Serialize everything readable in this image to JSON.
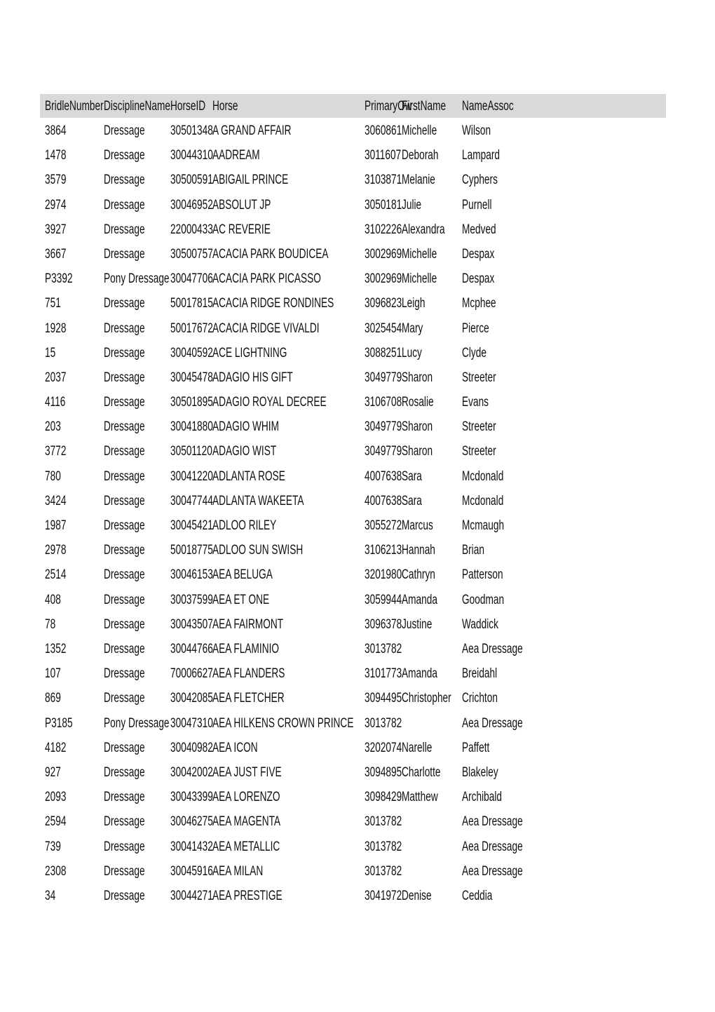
{
  "table": {
    "headers": [
      "BridleNumber",
      "DisciplineName",
      "HorseID",
      "Horse",
      "PrimaryOw",
      "FirstName",
      "NameAssoc"
    ],
    "rows": [
      [
        "3864",
        "Dressage",
        "30501348",
        "A GRAND AFFAIR",
        "3060861",
        "Michelle",
        "Wilson"
      ],
      [
        "1478",
        "Dressage",
        "30044310",
        "AADREAM",
        "3011607",
        "Deborah",
        "Lampard"
      ],
      [
        "3579",
        "Dressage",
        "30500591",
        "ABIGAIL PRINCE",
        "3103871",
        "Melanie",
        "Cyphers"
      ],
      [
        "2974",
        "Dressage",
        "30046952",
        "ABSOLUT JP",
        "3050181",
        "Julie",
        "Purnell"
      ],
      [
        "3927",
        "Dressage",
        "22000433",
        "AC REVERIE",
        "3102226",
        "Alexandra",
        "Medved"
      ],
      [
        "3667",
        "Dressage",
        "30500757",
        "ACACIA PARK BOUDICEA",
        "3002969",
        "Michelle",
        "Despax"
      ],
      [
        "P3392",
        "Pony Dressage",
        "30047706",
        "ACACIA PARK PICASSO",
        "3002969",
        "Michelle",
        "Despax"
      ],
      [
        "751",
        "Dressage",
        "50017815",
        "ACACIA RIDGE RONDINES",
        "3096823",
        "Leigh",
        "Mcphee"
      ],
      [
        "1928",
        "Dressage",
        "50017672",
        "ACACIA RIDGE VIVALDI",
        "3025454",
        "Mary",
        "Pierce"
      ],
      [
        "15",
        "Dressage",
        "30040592",
        "ACE LIGHTNING",
        "3088251",
        "Lucy",
        "Clyde"
      ],
      [
        "2037",
        "Dressage",
        "30045478",
        "ADAGIO HIS GIFT",
        "3049779",
        "Sharon",
        "Streeter"
      ],
      [
        "4116",
        "Dressage",
        "30501895",
        "ADAGIO ROYAL DECREE",
        "3106708",
        "Rosalie",
        "Evans"
      ],
      [
        "203",
        "Dressage",
        "30041880",
        "ADAGIO WHIM",
        "3049779",
        "Sharon",
        "Streeter"
      ],
      [
        "3772",
        "Dressage",
        "30501120",
        "ADAGIO WIST",
        "3049779",
        "Sharon",
        "Streeter"
      ],
      [
        "780",
        "Dressage",
        "30041220",
        "ADLANTA ROSE",
        "4007638",
        "Sara",
        "Mcdonald"
      ],
      [
        "3424",
        "Dressage",
        "30047744",
        "ADLANTA WAKEETA",
        "4007638",
        "Sara",
        "Mcdonald"
      ],
      [
        "1987",
        "Dressage",
        "30045421",
        "ADLOO RILEY",
        "3055272",
        "Marcus",
        "Mcmaugh"
      ],
      [
        "2978",
        "Dressage",
        "50018775",
        "ADLOO SUN SWISH",
        "3106213",
        "Hannah",
        "Brian"
      ],
      [
        "2514",
        "Dressage",
        "30046153",
        "AEA BELUGA",
        "3201980",
        "Cathryn",
        "Patterson"
      ],
      [
        "408",
        "Dressage",
        "30037599",
        "AEA ET ONE",
        "3059944",
        "Amanda",
        "Goodman"
      ],
      [
        "78",
        "Dressage",
        "30043507",
        "AEA FAIRMONT",
        "3096378",
        "Justine",
        "Waddick"
      ],
      [
        "1352",
        "Dressage",
        "30044766",
        "AEA FLAMINIO",
        "3013782",
        "",
        "Aea Dressage"
      ],
      [
        "107",
        "Dressage",
        "70006627",
        "AEA FLANDERS",
        "3101773",
        "Amanda",
        "Breidahl"
      ],
      [
        "869",
        "Dressage",
        "30042085",
        "AEA FLETCHER",
        "3094495",
        "Christopher",
        "Crichton"
      ],
      [
        "P3185",
        "Pony Dressage",
        "30047310",
        "AEA HILKENS CROWN PRINCE",
        "3013782",
        "",
        "Aea Dressage"
      ],
      [
        "4182",
        "Dressage",
        "30040982",
        "AEA ICON",
        "3202074",
        "Narelle",
        "Paffett"
      ],
      [
        "927",
        "Dressage",
        "30042002",
        "AEA JUST FIVE",
        "3094895",
        "Charlotte",
        "Blakeley"
      ],
      [
        "2093",
        "Dressage",
        "30043399",
        "AEA LORENZO",
        "3098429",
        "Matthew",
        "Archibald"
      ],
      [
        "2594",
        "Dressage",
        "30046275",
        "AEA MAGENTA",
        "3013782",
        "",
        "Aea Dressage"
      ],
      [
        "739",
        "Dressage",
        "30041432",
        "AEA METALLIC",
        "3013782",
        "",
        "Aea Dressage"
      ],
      [
        "2308",
        "Dressage",
        "30045916",
        "AEA MILAN",
        "3013782",
        "",
        "Aea Dressage"
      ],
      [
        "34",
        "Dressage",
        "30044271",
        "AEA PRESTIGE",
        "3041972",
        "Denise",
        "Ceddia"
      ]
    ]
  }
}
